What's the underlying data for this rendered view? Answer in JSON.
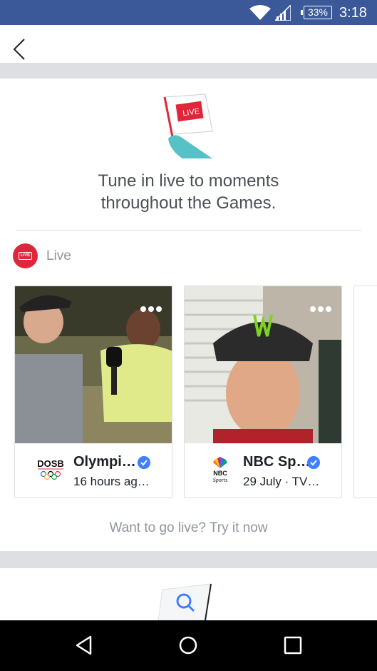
{
  "status_bar": {
    "battery": "33%",
    "time": "3:18"
  },
  "top_bar": {
    "back_icon": "chevron-left-icon"
  },
  "hero": {
    "flag_text": "LIVE",
    "headline_line1": "Tune in live to moments",
    "headline_line2": "throughout the Games."
  },
  "section": {
    "label": "Live",
    "badge_text": "LIVE"
  },
  "cards": [
    {
      "name": "Olympi…",
      "subtitle": "16 hours ag…",
      "logo_text": "DOSB",
      "verified": true
    },
    {
      "name": "NBC Sp…",
      "subtitle": "29 July · TV…",
      "logo_text": "NBC Sports",
      "verified": true
    }
  ],
  "try_link": "Want to go live? Try it now",
  "colors": {
    "status_bar": "#3b5998",
    "live_red": "#e0263a",
    "verified_blue": "#4080ff",
    "divider_gray": "#dddfe2"
  }
}
